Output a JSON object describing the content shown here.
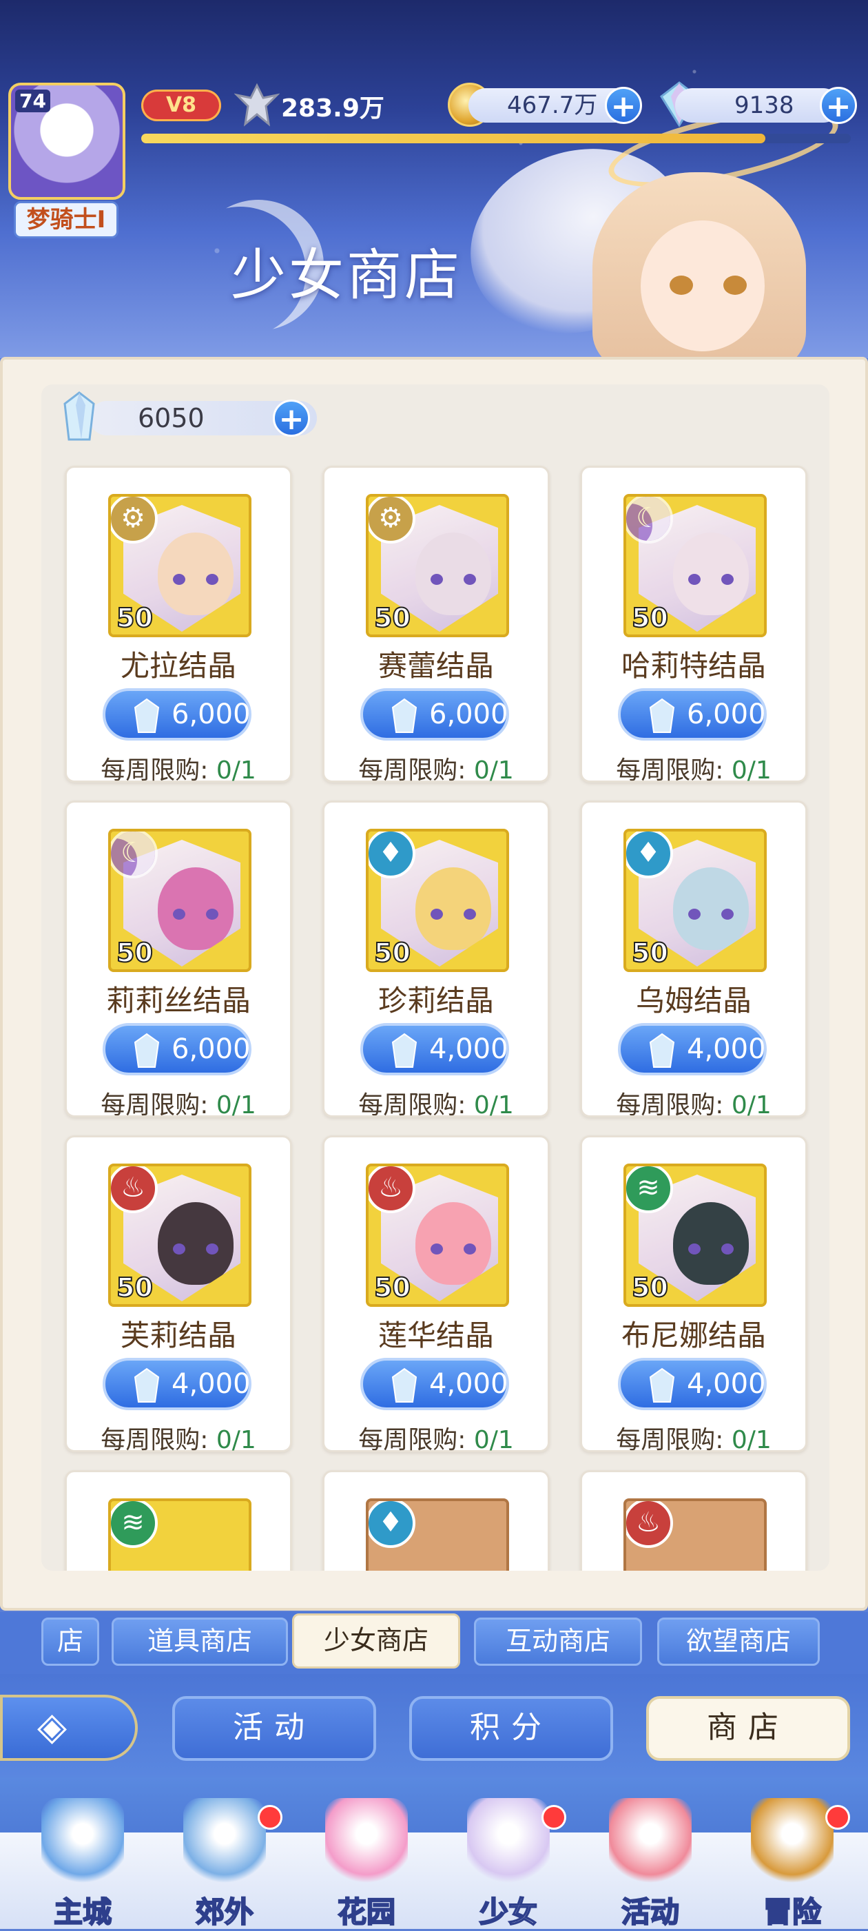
{
  "header": {
    "title": "少女商店",
    "level": "74",
    "player_title": "梦骑士I",
    "vip": "V8",
    "power": "283.9万",
    "coins": "467.7万",
    "gems": "9138",
    "exp_progress": 0.88
  },
  "shop": {
    "balance": "6050",
    "items": [
      {
        "name": "尤拉结晶",
        "qty": "50",
        "price": "6,000",
        "limit_label": "每周限购:",
        "limit_value": "0/1",
        "element": "sun",
        "element_icon": "⚙"
      },
      {
        "name": "赛蕾结晶",
        "qty": "50",
        "price": "6,000",
        "limit_label": "每周限购:",
        "limit_value": "0/1",
        "element": "sun",
        "element_icon": "⚙"
      },
      {
        "name": "哈莉特结晶",
        "qty": "50",
        "price": "6,000",
        "limit_label": "每周限购:",
        "limit_value": "0/1",
        "element": "moon",
        "element_icon": "☾"
      },
      {
        "name": "莉莉丝结晶",
        "qty": "50",
        "price": "6,000",
        "limit_label": "每周限购:",
        "limit_value": "0/1",
        "element": "moon",
        "element_icon": "☾"
      },
      {
        "name": "珍莉结晶",
        "qty": "50",
        "price": "4,000",
        "limit_label": "每周限购:",
        "limit_value": "0/1",
        "element": "water",
        "element_icon": "♦"
      },
      {
        "name": "乌姆结晶",
        "qty": "50",
        "price": "4,000",
        "limit_label": "每周限购:",
        "limit_value": "0/1",
        "element": "water",
        "element_icon": "♦"
      },
      {
        "name": "芙莉结晶",
        "qty": "50",
        "price": "4,000",
        "limit_label": "每周限购:",
        "limit_value": "0/1",
        "element": "fire",
        "element_icon": "♨"
      },
      {
        "name": "莲华结晶",
        "qty": "50",
        "price": "4,000",
        "limit_label": "每周限购:",
        "limit_value": "0/1",
        "element": "fire",
        "element_icon": "♨"
      },
      {
        "name": "布尼娜结晶",
        "qty": "50",
        "price": "4,000",
        "limit_label": "每周限购:",
        "limit_value": "0/1",
        "element": "wind",
        "element_icon": "≋"
      }
    ],
    "partial_row": [
      {
        "element": "wind",
        "element_icon": "≋",
        "style": "gold"
      },
      {
        "element": "water",
        "element_icon": "♦",
        "style": "brown"
      },
      {
        "element": "fire",
        "element_icon": "♨",
        "style": "brown"
      }
    ]
  },
  "shop_tabs": [
    "店",
    "道具商店",
    "少女商店",
    "互动商店",
    "欲望商店"
  ],
  "active_shop_tab": "少女商店",
  "subnav": {
    "back_icon": "◈",
    "activity": "活动",
    "points": "积分",
    "shop": "商店"
  },
  "bottom_nav": [
    {
      "label": "主城",
      "badge": false,
      "color": "#6fa8e8"
    },
    {
      "label": "郊外",
      "badge": true,
      "color": "#7cb0e6"
    },
    {
      "label": "花园",
      "badge": false,
      "color": "#f49cc9"
    },
    {
      "label": "少女",
      "badge": true,
      "color": "#d8c8f2"
    },
    {
      "label": "活动",
      "badge": false,
      "color": "#f08a9a"
    },
    {
      "label": "冒险",
      "badge": true,
      "color": "#d89a3c"
    }
  ],
  "colors": {
    "accent": "#2f6de2",
    "limit_value": "#2f8a4a",
    "gold_thumb": "#f2d23d"
  }
}
